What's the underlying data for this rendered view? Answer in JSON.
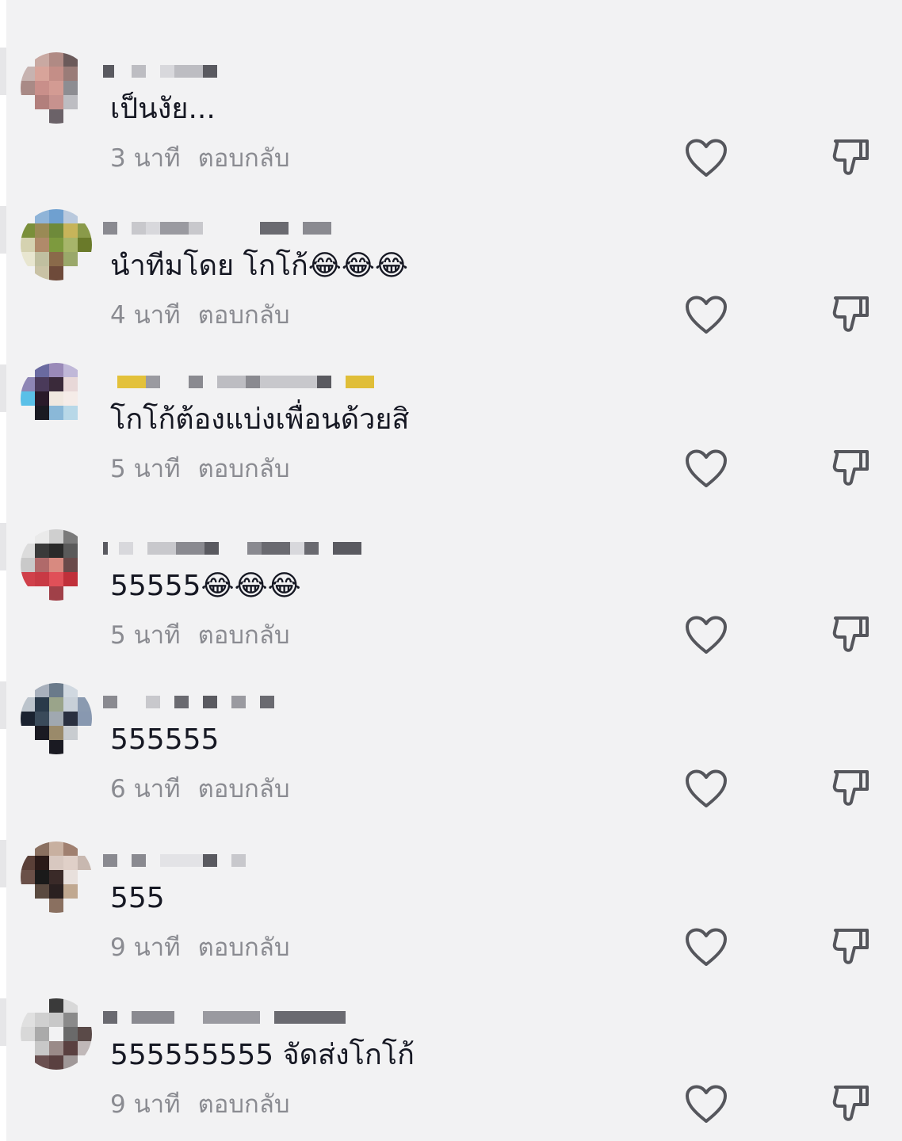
{
  "comments": [
    {
      "text": "เป็นงัย...",
      "time": "3 นาที",
      "reply": "ตอบกลับ"
    },
    {
      "text": "นำทีมโดย โกโก้😂😂😂",
      "time": "4 นาที",
      "reply": "ตอบกลับ"
    },
    {
      "text": "โกโก้ต้องแบ่งเพื่อนด้วยสิ",
      "time": "5 นาที",
      "reply": "ตอบกลับ"
    },
    {
      "text": "55555😂😂😂",
      "time": "5 นาที",
      "reply": "ตอบกลับ"
    },
    {
      "text": "555555",
      "time": "6 นาที",
      "reply": "ตอบกลับ"
    },
    {
      "text": "555",
      "time": "9 นาที",
      "reply": "ตอบกลับ"
    },
    {
      "text": "555555555 จัดส่งโกโก้",
      "time": "9 นาที",
      "reply": "ตอบกลับ"
    }
  ],
  "icons": {
    "like": "heart-outline-icon",
    "dislike": "thumbs-down-outline-icon"
  },
  "colors": {
    "background": "#f2f2f3",
    "text": "#161823",
    "meta": "#8a8b91",
    "icon": "#55565c"
  }
}
